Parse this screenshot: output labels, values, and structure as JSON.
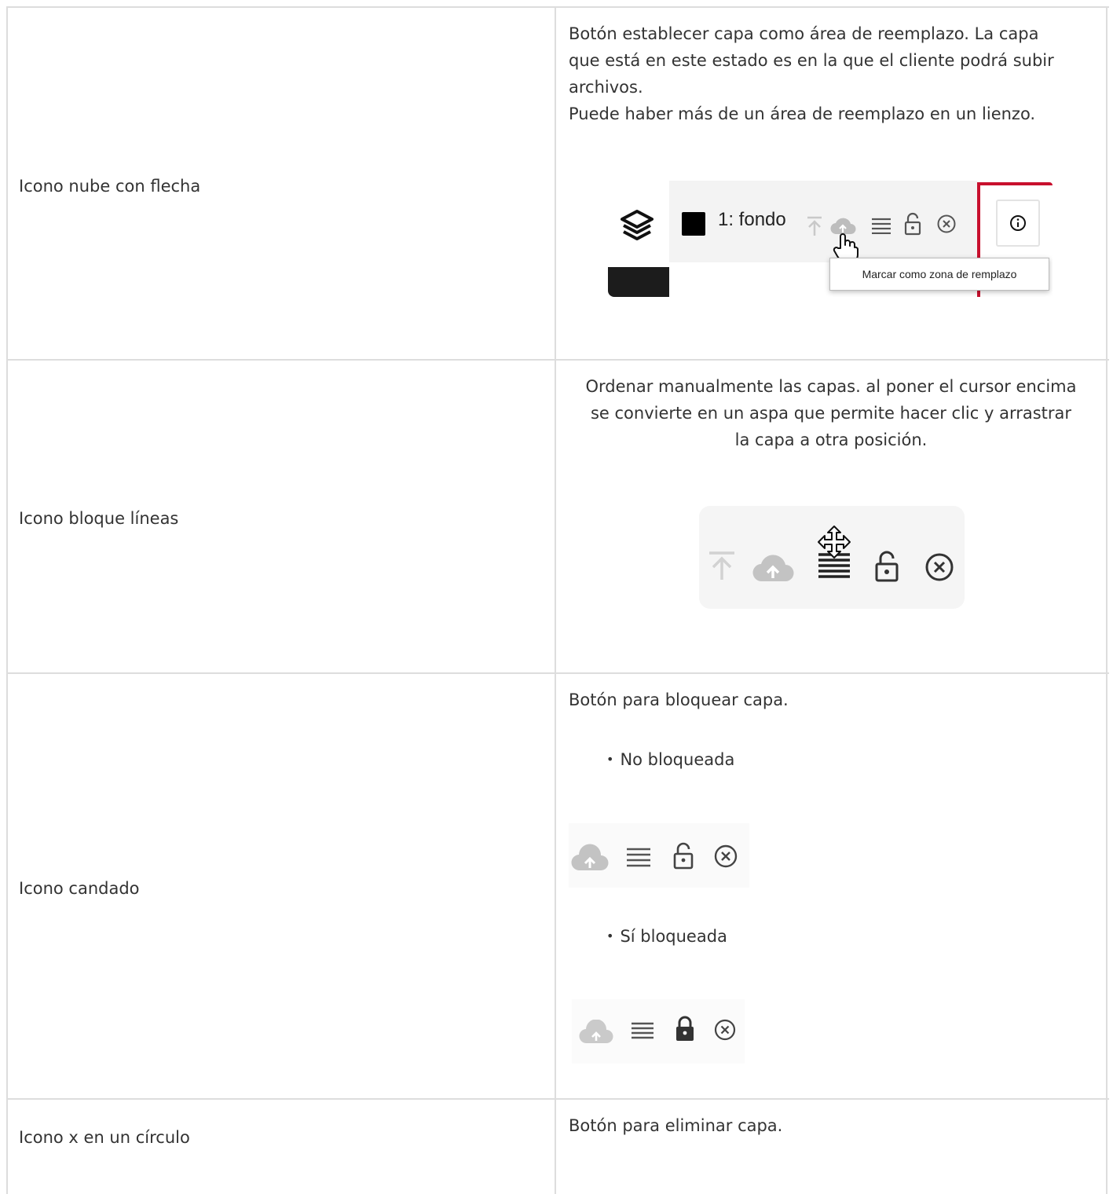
{
  "rows": [
    {
      "label": "Icono nube con flecha",
      "desc_lines": [
        "Botón establecer capa como área de reemplazo. La capa",
        "que está en este estado es en la que el cliente podrá subir",
        "archivos.",
        "Puede haber más de un área de reemplazo en un lienzo."
      ],
      "screenshot": {
        "layer_name": "1: fondo",
        "tooltip": "Marcar como zona de remplazo"
      }
    },
    {
      "label": "Icono bloque líneas",
      "desc_lines": [
        "Ordenar manualmente las capas. al poner el cursor encima",
        "se convierte en un aspa que permite hacer clic y arrastrar",
        "la capa a otra posición."
      ]
    },
    {
      "label": "Icono candado",
      "desc": "Botón para bloquear capa.",
      "bullets": [
        "No bloqueada",
        "Sí bloqueada"
      ]
    },
    {
      "label": "Icono x en un círculo",
      "desc": "Botón para eliminar capa."
    }
  ],
  "colors": {
    "border": "#dddddd",
    "text": "#333333",
    "accent_red": "#c8102e",
    "icon_gray": "#bdbdbd",
    "icon_dark": "#333333"
  }
}
